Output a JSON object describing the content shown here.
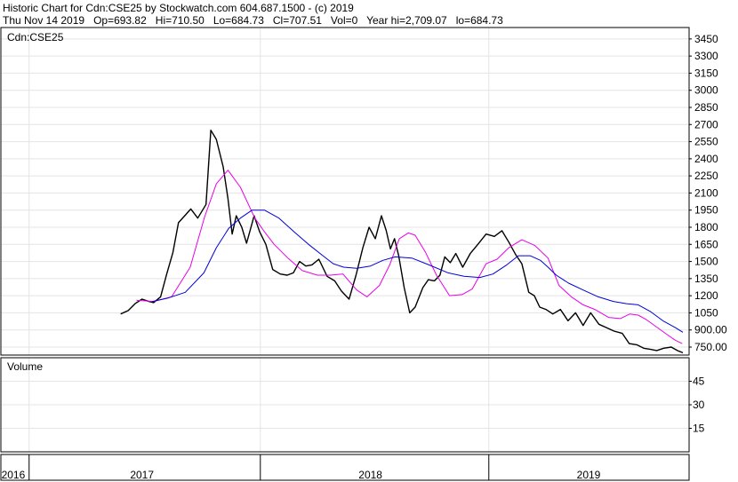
{
  "header": {
    "line1": "Historic Chart for Cdn:CSE25 by Stockwatch.com 604.687.1500 - (c) 2019",
    "line2": "Thu Nov 14 2019   Op=693.82   Hi=710.50   Lo=684.73   Cl=707.51   Vol=0   Year hi=2,709.07   lo=684.73"
  },
  "chart_data": [
    {
      "type": "line",
      "title": "Cdn:CSE25",
      "y_ticks": [
        "3450",
        "3300",
        "3150",
        "3000",
        "2850",
        "2700",
        "2550",
        "2400",
        "2250",
        "2100",
        "1950",
        "1800",
        "1650",
        "1500",
        "1350",
        "1200",
        "1050",
        "900.00",
        "750.00"
      ],
      "ylim": [
        680,
        3550
      ],
      "xlim": [
        0,
        100
      ],
      "grid": true,
      "series": [
        {
          "color": "#000000",
          "x": [
            17.4,
            18.5,
            19.5,
            20.5,
            21.5,
            22.2,
            23.2,
            24.1,
            25.0,
            25.8,
            26.7,
            27.6,
            28.6,
            29.8,
            30.5,
            31.3,
            32.3,
            33.0,
            33.6,
            34.2,
            35.0,
            35.7,
            36.2,
            36.8,
            37.6,
            38.5,
            39.5,
            40.6,
            41.6,
            42.5,
            43.4,
            44.3,
            45.2,
            46.2,
            47.4,
            48.5,
            49.5,
            50.6,
            51.6,
            52.6,
            53.5,
            54.4,
            55.3,
            56.0,
            56.6,
            57.2,
            57.8,
            58.6,
            59.4,
            60.2,
            61.3,
            62.1,
            63.0,
            63.8,
            64.5,
            65.3,
            66.1,
            67.1,
            68.2,
            69.3,
            70.5,
            71.7,
            72.8,
            73.8,
            74.8,
            75.7,
            76.7,
            77.5,
            78.3,
            79.2,
            80.2,
            81.3,
            82.4,
            83.5,
            84.6,
            85.7,
            86.9,
            88.0,
            89.1,
            90.3,
            91.3,
            92.4,
            93.4,
            94.4,
            95.3,
            96.3,
            97.4,
            98.3,
            99.1
          ],
          "values": [
            1040,
            1070,
            1130,
            1170,
            1150,
            1140,
            1190,
            1390,
            1580,
            1840,
            1900,
            1960,
            1880,
            2000,
            2650,
            2570,
            2330,
            2050,
            1740,
            1900,
            1800,
            1660,
            1770,
            1900,
            1760,
            1650,
            1430,
            1390,
            1380,
            1400,
            1500,
            1460,
            1470,
            1520,
            1370,
            1330,
            1240,
            1170,
            1380,
            1620,
            1800,
            1700,
            1900,
            1770,
            1610,
            1700,
            1550,
            1270,
            1050,
            1100,
            1270,
            1340,
            1330,
            1380,
            1540,
            1490,
            1570,
            1450,
            1570,
            1650,
            1740,
            1720,
            1770,
            1670,
            1560,
            1480,
            1230,
            1200,
            1100,
            1080,
            1040,
            1080,
            980,
            1050,
            940,
            1050,
            950,
            920,
            890,
            870,
            780,
            770,
            740,
            730,
            720,
            740,
            750,
            720,
            700
          ]
        },
        {
          "color": "#e800e8",
          "x": [
            19.7,
            22.2,
            24.8,
            27.5,
            29.6,
            31.3,
            33.0,
            34.8,
            36.9,
            38.3,
            39.7,
            41.7,
            43.8,
            46.0,
            47.9,
            49.7,
            51.7,
            53.2,
            55.0,
            56.5,
            57.9,
            59.2,
            60.2,
            61.7,
            63.3,
            65.2,
            67.0,
            68.5,
            70.5,
            72.1,
            73.8,
            75.7,
            77.6,
            79.5,
            81.1,
            82.9,
            84.6,
            86.3,
            88.3,
            90.0,
            91.4,
            92.6,
            93.8,
            95.4,
            96.8,
            98.0,
            99.0
          ],
          "values": [
            1160,
            1150,
            1190,
            1450,
            1890,
            2180,
            2300,
            2150,
            1880,
            1760,
            1650,
            1530,
            1420,
            1380,
            1380,
            1390,
            1250,
            1190,
            1290,
            1470,
            1700,
            1750,
            1730,
            1580,
            1380,
            1200,
            1210,
            1260,
            1480,
            1520,
            1620,
            1690,
            1640,
            1530,
            1290,
            1190,
            1120,
            1080,
            1010,
            1000,
            1040,
            1030,
            990,
            920,
            860,
            810,
            780
          ]
        },
        {
          "color": "#0000d8",
          "x": [
            22.0,
            24.3,
            26.8,
            29.5,
            31.3,
            33.1,
            34.8,
            36.5,
            38.3,
            40.4,
            42.6,
            44.7,
            46.8,
            48.3,
            49.8,
            51.7,
            53.7,
            55.5,
            57.3,
            59.7,
            62.2,
            65.0,
            67.3,
            69.6,
            71.5,
            73.5,
            75.2,
            76.9,
            78.4,
            79.5,
            80.7,
            82.5,
            84.6,
            86.8,
            89.0,
            90.9,
            92.6,
            94.4,
            96.2,
            98.0,
            99.1
          ],
          "values": [
            1150,
            1180,
            1230,
            1400,
            1620,
            1790,
            1880,
            1950,
            1950,
            1880,
            1760,
            1650,
            1550,
            1480,
            1450,
            1440,
            1460,
            1510,
            1540,
            1530,
            1470,
            1400,
            1370,
            1360,
            1390,
            1470,
            1550,
            1550,
            1510,
            1450,
            1380,
            1310,
            1250,
            1190,
            1150,
            1130,
            1120,
            1060,
            980,
            920,
            880
          ]
        }
      ]
    },
    {
      "type": "bar",
      "title": "Volume",
      "y_ticks": [
        "45",
        "30",
        "15"
      ],
      "ylim": [
        0,
        60
      ],
      "values": []
    }
  ],
  "time_axis": {
    "labels": [
      "2016",
      "2017",
      "2018",
      "2019"
    ],
    "xlim": [
      0,
      100
    ],
    "label_positions": [
      1.8,
      20.5,
      53.7,
      85.4
    ],
    "year_boundaries": [
      4.1,
      37.7,
      70.9
    ]
  }
}
